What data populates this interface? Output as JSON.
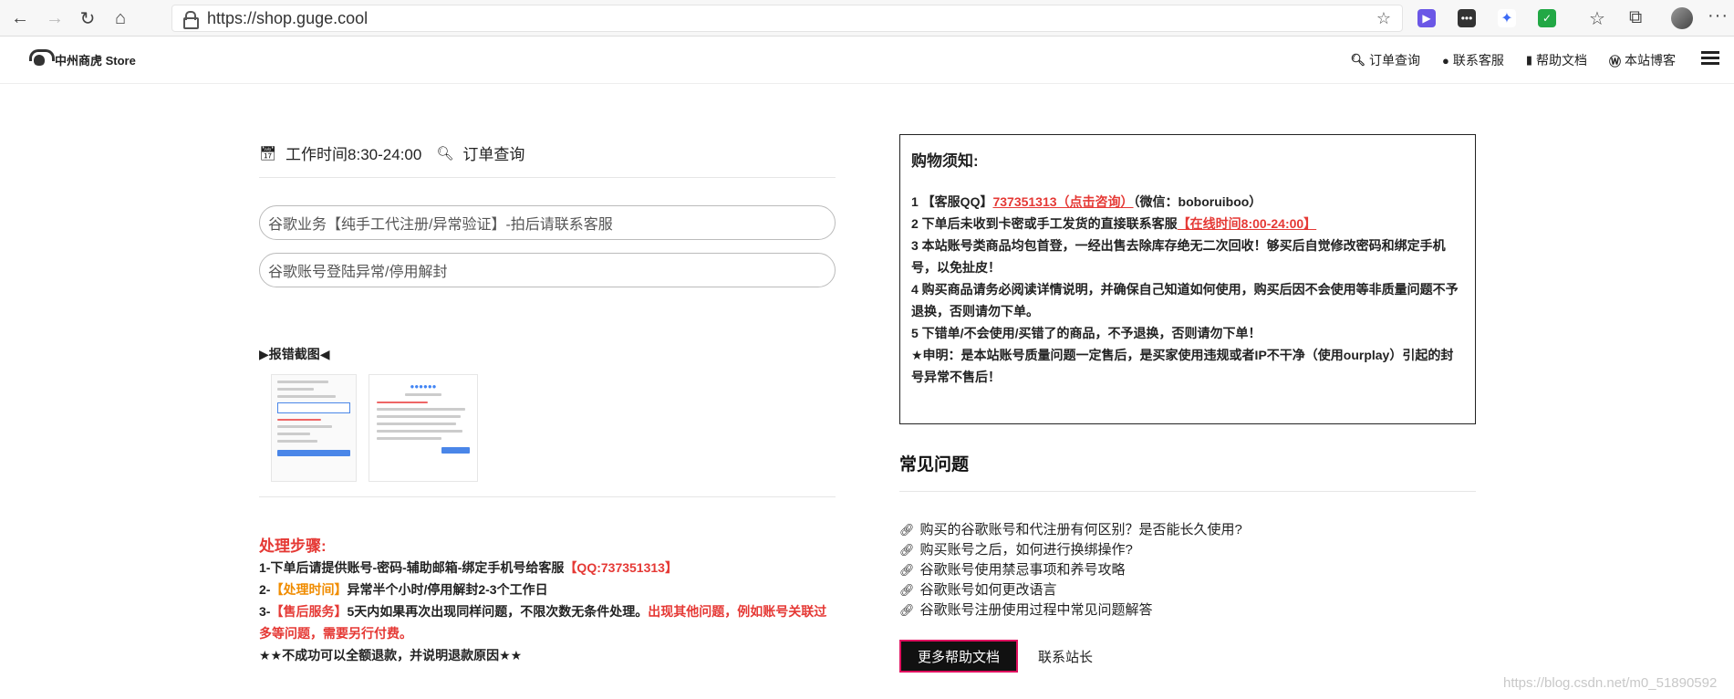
{
  "browser": {
    "url": "https://shop.guge.cool",
    "icons": [
      "back-arrow-icon",
      "forward-arrow-icon",
      "refresh-icon",
      "home-icon",
      "lock-icon",
      "favorite-star-icon",
      "extension-icons",
      "favorites-icon",
      "collections-icon",
      "profile-avatar",
      "more-icon"
    ]
  },
  "header": {
    "logo_text": "中州商虎 Store",
    "nav": [
      {
        "icon": "search-icon",
        "label": "订单查询"
      },
      {
        "icon": "qq-icon",
        "label": "联系客服"
      },
      {
        "icon": "bookmark-icon",
        "label": "帮助文档"
      },
      {
        "icon": "wordpress-icon",
        "label": "本站博客"
      }
    ]
  },
  "left": {
    "work_time": "工作时间8:30-24:00",
    "order_query": "订单查询",
    "field1_value": "谷歌业务【纯手工代注册/异常验证】-拍后请联系客服",
    "field2_value": "谷歌账号登陆异常/停用解封",
    "screenshot_label": "▶报错截图◀",
    "steps_title": "处理步骤:",
    "steps": {
      "s1_prefix": "1-下单后请提供账号-密码-辅助邮箱-绑定手机号给客服",
      "s1_highlight": "【QQ:737351313】",
      "s2_prefix": "2-",
      "s2_highlight": "【处理时间】",
      "s2_suffix": "异常半个小时/停用解封2-3个工作日",
      "s3_prefix": "3-",
      "s3_highlight": "【售后服务】",
      "s3_mid": "5天内如果再次出现同样问题，不限次数无条件处理。",
      "s3_red": "出现其他问题，例如账号关联过多等问题，需要另行付费。",
      "s4": "★★不成功可以全额退款，并说明退款原因★★"
    }
  },
  "notice": {
    "title": "购物须知:",
    "l1_prefix": "1 【客服QQ】",
    "l1_link": "737351313（点击咨询）",
    "l1_suffix": "（微信：boboruiboo）",
    "l2_prefix": "2 下单后未收到卡密或手工发货的直接联系客服",
    "l2_link": "【在线时间8:00-24:00】",
    "l3": "3 本站账号类商品均包首登，一经出售去除库存绝无二次回收！够买后自觉修改密码和绑定手机号，以免扯皮！",
    "l4": "4 购买商品请务必阅读详情说明，并确保自己知道如何使用，购买后因不会使用等非质量问题不予退换，否则请勿下单。",
    "l5": "5 下错单/不会使用/买错了的商品，不予退换，否则请勿下单！",
    "l6": "★申明：是本站账号质量问题一定售后，是买家使用违规或者IP不干净（使用ourplay）引起的封号异常不售后！"
  },
  "faq": {
    "title": "常见问题",
    "items": [
      "购买的谷歌账号和代注册有何区别？是否能长久使用?",
      "购买账号之后，如何进行换绑操作?",
      "谷歌账号使用禁忌事项和养号攻略",
      "谷歌账号如何更改语言",
      "谷歌账号注册使用过程中常见问题解答"
    ],
    "more_button": "更多帮助文档",
    "contact_link": "联系站长"
  },
  "watermark": "https://blog.csdn.net/m0_51890592",
  "colors": {
    "accent_red": "#e53935",
    "accent_orange": "#f08c00",
    "button_border": "#e0115f"
  }
}
